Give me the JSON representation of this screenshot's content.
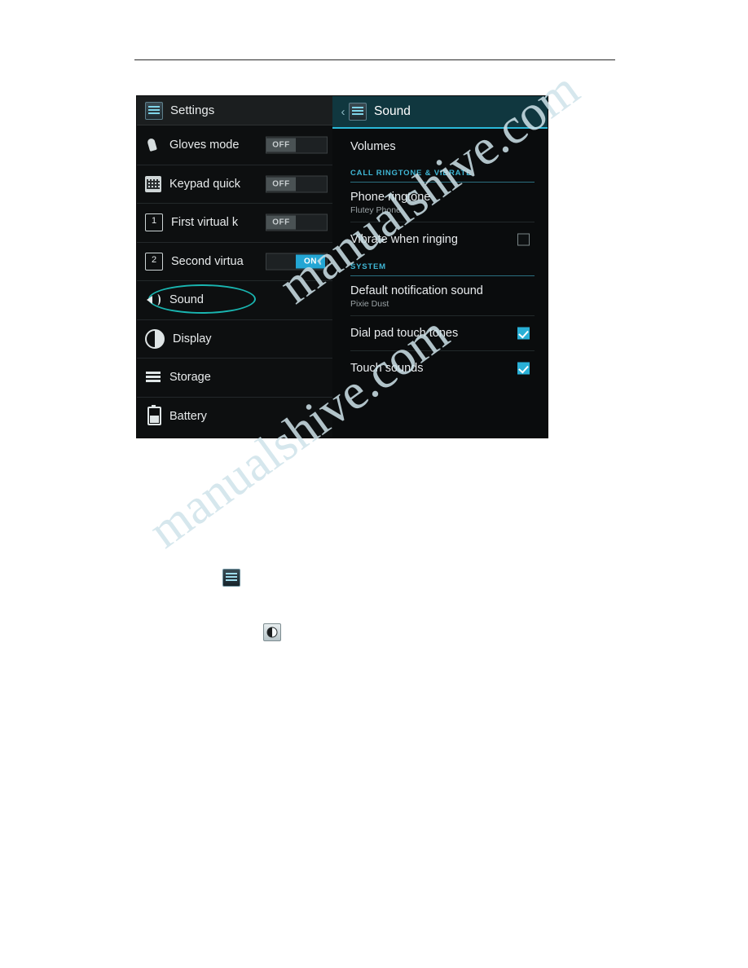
{
  "watermark": {
    "line1": "manualshive.com",
    "line2": "manualshive.com"
  },
  "settings_pane": {
    "header": {
      "icon": "settings-tiles-icon",
      "title": "Settings"
    },
    "items": [
      {
        "icon": "glove-icon",
        "label": "Gloves mode",
        "toggle": "OFF",
        "state": "off"
      },
      {
        "icon": "keypad-icon",
        "label": "Keypad quick",
        "toggle": "OFF",
        "state": "off"
      },
      {
        "icon": "number-1-icon",
        "label": "First virtual k",
        "toggle": "OFF",
        "state": "off"
      },
      {
        "icon": "number-2-icon",
        "label": "Second virtua",
        "toggle": "ON",
        "state": "on"
      },
      {
        "icon": "sound-icon",
        "label": "Sound",
        "toggle": "",
        "state": "none"
      },
      {
        "icon": "display-icon",
        "label": "Display",
        "toggle": "",
        "state": "none"
      },
      {
        "icon": "storage-icon",
        "label": "Storage",
        "toggle": "",
        "state": "none"
      },
      {
        "icon": "battery-icon",
        "label": "Battery",
        "toggle": "",
        "state": "none"
      }
    ],
    "highlight_target": "Sound",
    "highlight_color": "#19b5b0"
  },
  "sound_pane": {
    "header": {
      "back": "‹",
      "icon": "settings-tiles-icon",
      "title": "Sound"
    },
    "rows": [
      {
        "type": "item",
        "title": "Volumes"
      },
      {
        "type": "header",
        "title": "CALL RINGTONE & VIBRATE"
      },
      {
        "type": "item",
        "title": "Phone ringtone",
        "subtitle": "Flutey Phone"
      },
      {
        "type": "check",
        "title": "Vibrate when ringing",
        "checked": false
      },
      {
        "type": "header",
        "title": "SYSTEM"
      },
      {
        "type": "item",
        "title": "Default notification sound",
        "subtitle": "Pixie Dust"
      },
      {
        "type": "check",
        "title": "Dial pad touch tones",
        "checked": true
      },
      {
        "type": "check",
        "title": "Touch sounds",
        "checked": true
      }
    ],
    "accent_color": "#2ab8d8"
  },
  "figures": [
    {
      "name": "settings-tiles-icon"
    },
    {
      "name": "brightness-icon"
    }
  ]
}
